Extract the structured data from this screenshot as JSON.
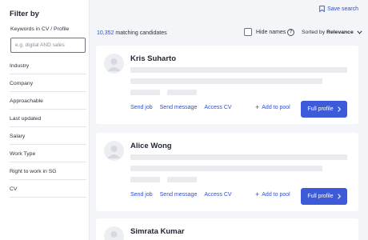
{
  "sidebar": {
    "title": "Filter by",
    "keywords_label": "Keywords in CV / Profile",
    "keywords_placeholder": "e.g. digital AND sales",
    "keywords_value": "",
    "filters": [
      "Industry",
      "Company",
      "Approachable",
      "Last updated",
      "Salary",
      "Work Type",
      "Right to work in SG",
      "CV"
    ]
  },
  "header": {
    "save_search": "Save search",
    "count": "10,352",
    "count_suffix": "matching candidates",
    "hide_names": "Hide names",
    "hide_names_checked": false,
    "help": "?",
    "sorted_by": "Sorted by",
    "sort_value": "Relevance"
  },
  "candidates": [
    {
      "name": "Kris Suharto",
      "actions": [
        "Send job",
        "Send message",
        "Access CV"
      ],
      "add_to_pool": "Add to pool",
      "full_profile": "Full profile"
    },
    {
      "name": "Alice Wong",
      "actions": [
        "Send job",
        "Send message",
        "Access CV"
      ],
      "add_to_pool": "Add to pool",
      "full_profile": "Full profile"
    },
    {
      "name": "Simrata Kumar"
    }
  ],
  "colors": {
    "accent": "#3d5bd9",
    "link": "#2f4fcc",
    "background": "#f4f5f8",
    "skeleton": "#e9ebef"
  }
}
